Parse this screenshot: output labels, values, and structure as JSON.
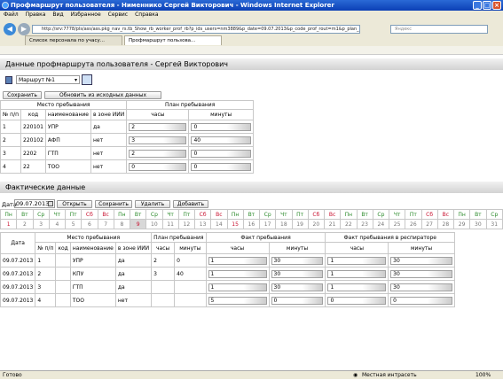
{
  "window": {
    "title": "Профмаршрут пользователя - Нименнико Сергей Викторович - Windows Internet Explorer",
    "menu": [
      "Файл",
      "Правка",
      "Вид",
      "Избранное",
      "Сервис",
      "Справка"
    ],
    "address": "http://srv:7778/pls/ass/ass.pkg_nav_rs.tb_Show_rb_worker_prof_rb?p_ids_users=nm3889&p_date=09.07.2013&p_code_prof_rout=m1&p_plan_num=1",
    "search_placeholder": "Яндекс",
    "tabs": [
      "Список персонала по учасу...",
      "Профмаршрут пользова..."
    ],
    "status_left": "Готово",
    "status_zone": "Местная интрасеть",
    "zoom": "100%"
  },
  "page": {
    "title": "Данные профмаршрута пользователя - Сергей Викторович",
    "route_select": "Маршрут №1",
    "btn_save": "Сохранить",
    "btn_refresh": "Обновить из исходных данных",
    "plan_table": {
      "h_place": "Место пребывания",
      "h_plan": "План пребывания",
      "h_num": "№ п/п",
      "h_code": "код",
      "h_name": "наименование",
      "h_zone": "в зоне ИИИ",
      "h_hours": "часы",
      "h_minutes": "минуты",
      "rows": [
        {
          "n": "1",
          "code": "220101",
          "name": "УПР",
          "zone": "да",
          "hours": "2",
          "minutes": "0"
        },
        {
          "n": "2",
          "code": "220102",
          "name": "АФП",
          "zone": "нет",
          "hours": "3",
          "minutes": "40"
        },
        {
          "n": "3",
          "code": "2202",
          "name": "ГТП",
          "zone": "нет",
          "hours": "2",
          "minutes": "0"
        },
        {
          "n": "4",
          "code": "22",
          "name": "ТОО",
          "zone": "нет",
          "hours": "0",
          "minutes": "0"
        }
      ]
    },
    "actual_title": "Фактические данные",
    "date_label": "Дата",
    "date_value": "09.07.2013",
    "btn_open": "Открыть",
    "btn_save2": "Сохранить",
    "btn_delete": "Удалить",
    "btn_add": "Добавить",
    "calendar": {
      "weekdays": [
        "Пн",
        "Вт",
        "Ср",
        "Чт",
        "Пт",
        "Сб",
        "Вс",
        "Пн",
        "Вт",
        "Ср",
        "Чт",
        "Пт",
        "Сб",
        "Вс",
        "Пн",
        "Вт",
        "Ср",
        "Чт",
        "Пт",
        "Сб",
        "Вс",
        "Пн",
        "Вт",
        "Ср",
        "Чт",
        "Пт",
        "Сб",
        "Вс",
        "Пн",
        "Вт",
        "Ср"
      ],
      "days": [
        "1",
        "2",
        "3",
        "4",
        "5",
        "6",
        "7",
        "8",
        "9",
        "10",
        "11",
        "12",
        "13",
        "14",
        "15",
        "16",
        "17",
        "18",
        "19",
        "20",
        "21",
        "22",
        "23",
        "24",
        "25",
        "26",
        "27",
        "28",
        "29",
        "30",
        "31"
      ],
      "red_days": [
        1,
        9,
        15
      ],
      "weekend_idx": [
        5,
        6,
        12,
        13,
        19,
        20,
        26,
        27
      ],
      "selected_day": 9
    },
    "fact_table": {
      "h_date": "Дата",
      "h_place": "Место пребывания",
      "h_plan": "План пребывания",
      "h_fact": "Факт пребывания",
      "h_fact_resp": "Факт пребывания в респираторе",
      "h_num": "№ п/п",
      "h_code": "код",
      "h_name": "наименование",
      "h_zone": "в зоне ИИИ",
      "h_hours": "часы",
      "h_minutes": "минуты",
      "rows": [
        {
          "date": "09.07.2013",
          "n": "1",
          "name": "УПР",
          "zone": "да",
          "ph": "2",
          "pm": "0",
          "fh": "1",
          "fm": "30",
          "rh": "1",
          "rm": "30"
        },
        {
          "date": "09.07.2013",
          "n": "2",
          "name": "КПУ",
          "zone": "да",
          "ph": "3",
          "pm": "40",
          "fh": "1",
          "fm": "30",
          "rh": "1",
          "rm": "30"
        },
        {
          "date": "09.07.2013",
          "n": "3",
          "name": "ГТП",
          "zone": "да",
          "ph": "",
          "pm": "",
          "fh": "1",
          "fm": "30",
          "rh": "1",
          "rm": "30"
        },
        {
          "date": "09.07.2013",
          "n": "4",
          "name": "ТОО",
          "zone": "нет",
          "ph": "",
          "pm": "",
          "fh": "5",
          "fm": "0",
          "rh": "0",
          "rm": "0"
        }
      ]
    }
  }
}
